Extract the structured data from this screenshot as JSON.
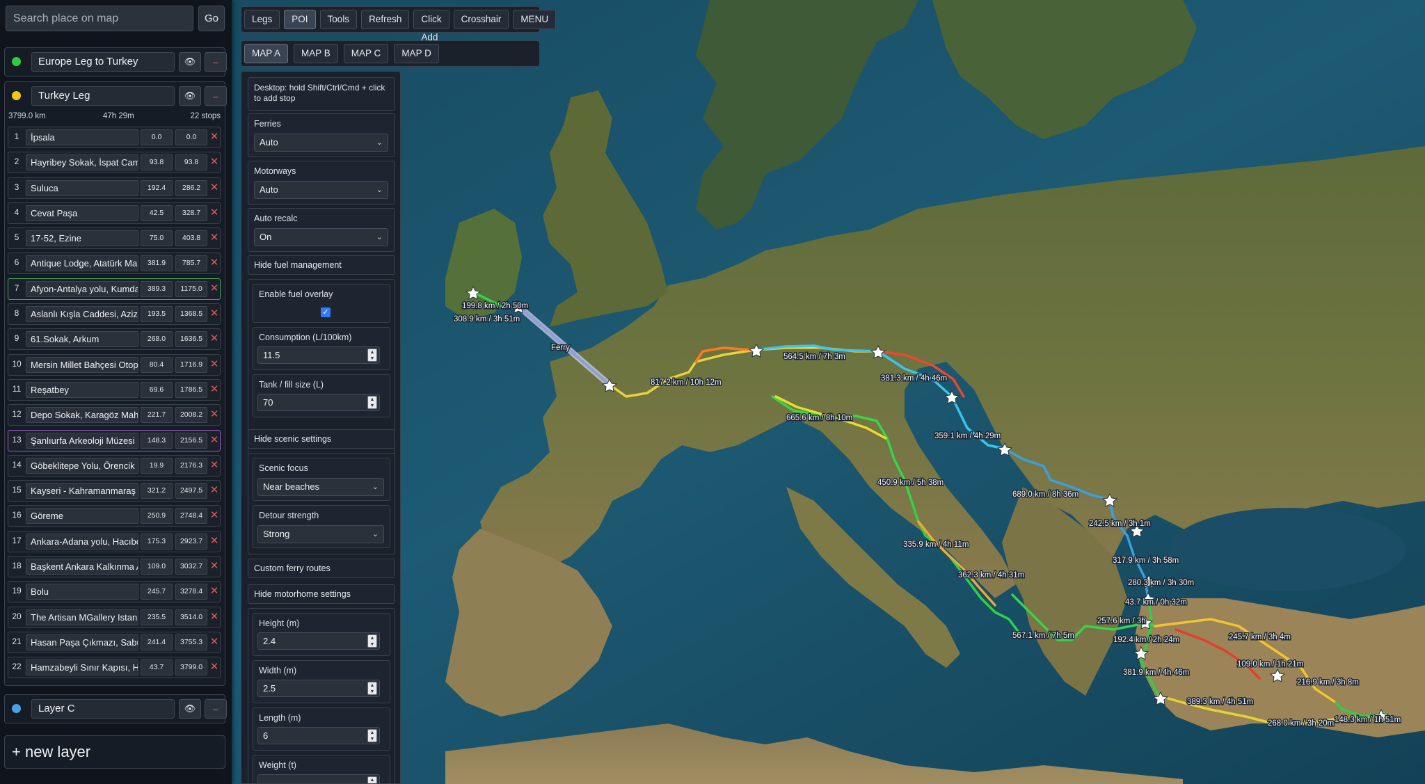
{
  "search": {
    "placeholder": "Search place on map",
    "go_label": "Go"
  },
  "layers": [
    {
      "name": "Europe Leg to Turkey",
      "color": "#2ecc40"
    },
    {
      "name": "Turkey Leg",
      "color": "#f5c518",
      "stats": {
        "distance": "3799.0 km",
        "duration": "47h 29m",
        "stops": "22 stops"
      },
      "stops": [
        {
          "n": "1",
          "name": "İpsala",
          "a": "0.0",
          "b": "0.0"
        },
        {
          "n": "2",
          "name": "Hayribey Sokak, İspat Cami",
          "a": "93.8",
          "b": "93.8"
        },
        {
          "n": "3",
          "name": "Suluca",
          "a": "192.4",
          "b": "286.2"
        },
        {
          "n": "4",
          "name": "Cevat Paşa",
          "a": "42.5",
          "b": "328.7"
        },
        {
          "n": "5",
          "name": "17-52, Ezine",
          "a": "75.0",
          "b": "403.8"
        },
        {
          "n": "6",
          "name": "Antique Lodge, Atatürk Mah",
          "a": "381.9",
          "b": "785.7"
        },
        {
          "n": "7",
          "name": "Afyon-Antalya yolu, Kumdanlı",
          "a": "389.3",
          "b": "1175.0"
        },
        {
          "n": "8",
          "name": "Aslanlı Kışla Caddesi, Aziziye",
          "a": "193.5",
          "b": "1368.5"
        },
        {
          "n": "9",
          "name": "61.Sokak, Arkum",
          "a": "268.0",
          "b": "1636.5"
        },
        {
          "n": "10",
          "name": "Mersin Millet Bahçesi Otopark",
          "a": "80.4",
          "b": "1716.9"
        },
        {
          "n": "11",
          "name": "Reşatbey",
          "a": "69.6",
          "b": "1786.5"
        },
        {
          "n": "12",
          "name": "Depo Sokak, Karagöz Mahallesi",
          "a": "221.7",
          "b": "2008.2"
        },
        {
          "n": "13",
          "name": "Şanlıurfa Arkeoloji Müzesi",
          "a": "148.3",
          "b": "2156.5"
        },
        {
          "n": "14",
          "name": "Göbeklitepe Yolu, Örencik",
          "a": "19.9",
          "b": "2176.3"
        },
        {
          "n": "15",
          "name": "Kayseri - Kahramanmaraş Yolu",
          "a": "321.2",
          "b": "2497.5"
        },
        {
          "n": "16",
          "name": "Göreme",
          "a": "250.9",
          "b": "2748.4"
        },
        {
          "n": "17",
          "name": "Ankara-Adana yolu, Hacıbektaş",
          "a": "175.3",
          "b": "2923.7"
        },
        {
          "n": "18",
          "name": "Başkent Ankara Kalkınma Ajansı",
          "a": "109.0",
          "b": "3032.7"
        },
        {
          "n": "19",
          "name": "Bolu",
          "a": "245.7",
          "b": "3278.4"
        },
        {
          "n": "20",
          "name": "The Artisan MGallery Istanbul",
          "a": "235.5",
          "b": "3514.0"
        },
        {
          "n": "21",
          "name": "Hasan Paşa Çıkmazı, Sabuncu",
          "a": "241.4",
          "b": "3755.3"
        },
        {
          "n": "22",
          "name": "Hamzabeyli Sınır Kapısı, Hamzabeyli",
          "a": "43.7",
          "b": "3799.0"
        }
      ]
    },
    {
      "name": "Layer C",
      "color": "#4aa3e8"
    }
  ],
  "new_layer_label": "+ new layer",
  "toolbar": {
    "buttons": [
      "Legs",
      "POI",
      "Tools",
      "Refresh",
      "Click Add",
      "Crosshair",
      "MENU"
    ],
    "active": "POI"
  },
  "maps": {
    "buttons": [
      "MAP A",
      "MAP B",
      "MAP C",
      "MAP D"
    ],
    "active": "MAP A"
  },
  "settings": {
    "hint": "Desktop: hold Shift/Ctrl/Cmd + click to add stop",
    "ferries": {
      "label": "Ferries",
      "value": "Auto"
    },
    "motorways": {
      "label": "Motorways",
      "value": "Auto"
    },
    "auto_recalc": {
      "label": "Auto recalc",
      "value": "On"
    },
    "fuel_header": "Hide fuel management",
    "fuel_overlay_label": "Enable fuel overlay",
    "fuel_overlay_checked": true,
    "consumption": {
      "label": "Consumption (L/100km)",
      "value": "11.5"
    },
    "tank": {
      "label": "Tank / fill size (L)",
      "value": "70"
    },
    "scenic_header": "Hide scenic settings",
    "scenic_focus": {
      "label": "Scenic focus",
      "value": "Near beaches"
    },
    "detour": {
      "label": "Detour strength",
      "value": "Strong"
    },
    "ferry_routes": "Custom ferry routes",
    "motorhome_header": "Hide motorhome settings",
    "height": {
      "label": "Height (m)",
      "value": "2.4"
    },
    "width": {
      "label": "Width (m)",
      "value": "2.5"
    },
    "length": {
      "label": "Length (m)",
      "value": "6"
    },
    "weight": {
      "label": "Weight (t)"
    }
  },
  "map_labels": {
    "ferry": "Ferry",
    "legs": [
      "199.8 km / 2h 50m",
      "308.9 km / 3h 51m",
      "817.2 km / 10h 12m",
      "564.5 km / 7h 3m",
      "381.3 km / 4h 46m",
      "665.6 km / 8h 10m",
      "359.1 km / 4h 29m",
      "450.9 km / 5h 38m",
      "689.0 km / 8h 36m",
      "242.5 km / 3h 1m",
      "335.9 km / 4h 11m",
      "317.9 km / 3h 58m",
      "362.3 km / 4h 31m",
      "280.3 km / 3h 30m",
      "43.7 km / 0h 32m",
      "257.6 km / 3h",
      "567.1 km / 7h 5m",
      "192.4 km / 2h 24m",
      "245.7 km / 3h 4m",
      "109.0 km / 1h 21m",
      "381.9 km / 4h 46m",
      "216.9 km / 3h 8m",
      "389.3 km / 4h 51m",
      "268.0 km / 3h 20m",
      "148.3 km / 1h 51m"
    ]
  }
}
